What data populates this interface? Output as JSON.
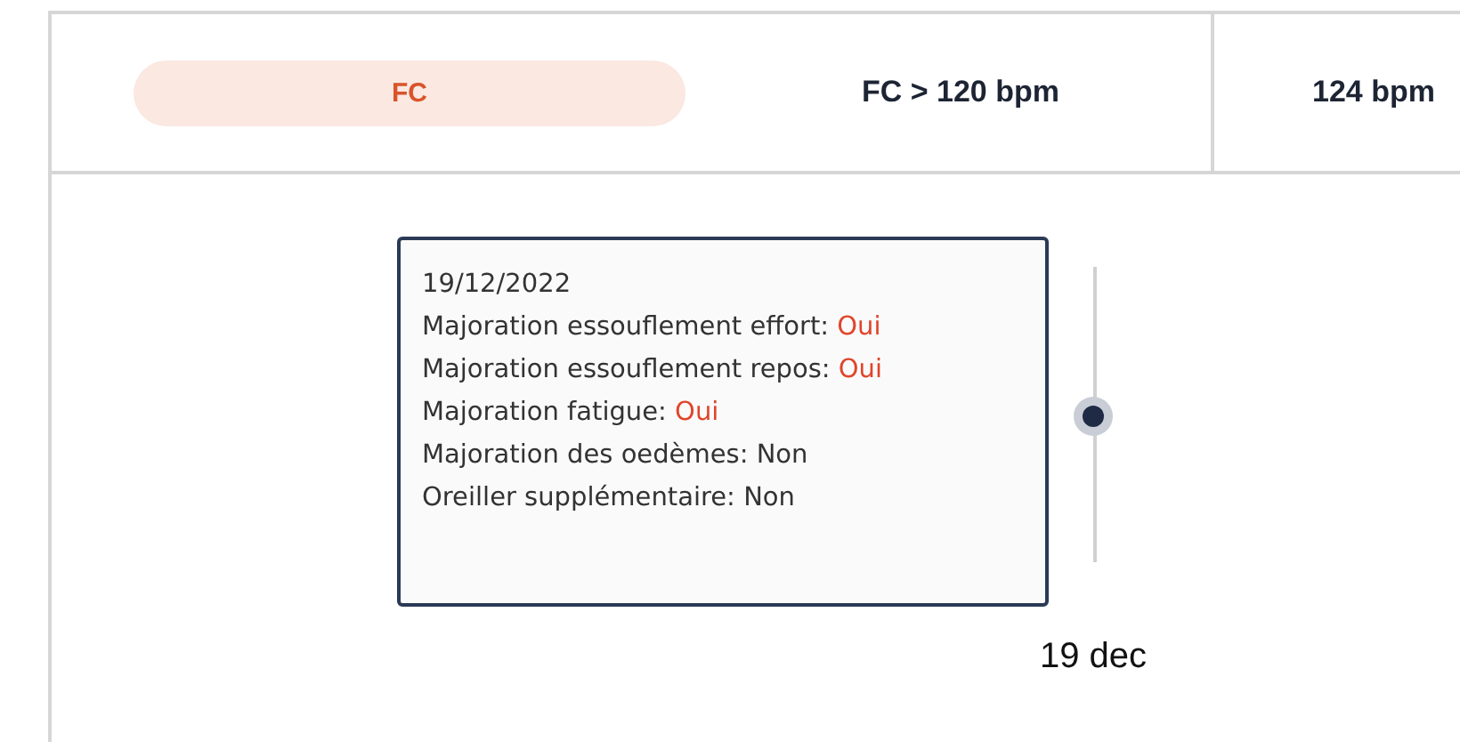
{
  "header": {
    "badge": "FC",
    "criterion": "FC > 120 bpm",
    "value": "124 bpm"
  },
  "tooltip": {
    "date": "19/12/2022",
    "rows": [
      {
        "label": "Majoration essouflement effort:",
        "value": "Oui",
        "alert": true
      },
      {
        "label": "Majoration essouflement repos:",
        "value": "Oui",
        "alert": true
      },
      {
        "label": "Majoration fatigue:",
        "value": "Oui",
        "alert": true
      },
      {
        "label": "Majoration des oedèmes:",
        "value": "Non",
        "alert": false
      },
      {
        "label": "Oreiller supplémentaire:",
        "value": "Non",
        "alert": false
      }
    ]
  },
  "annotation": "19 dec"
}
